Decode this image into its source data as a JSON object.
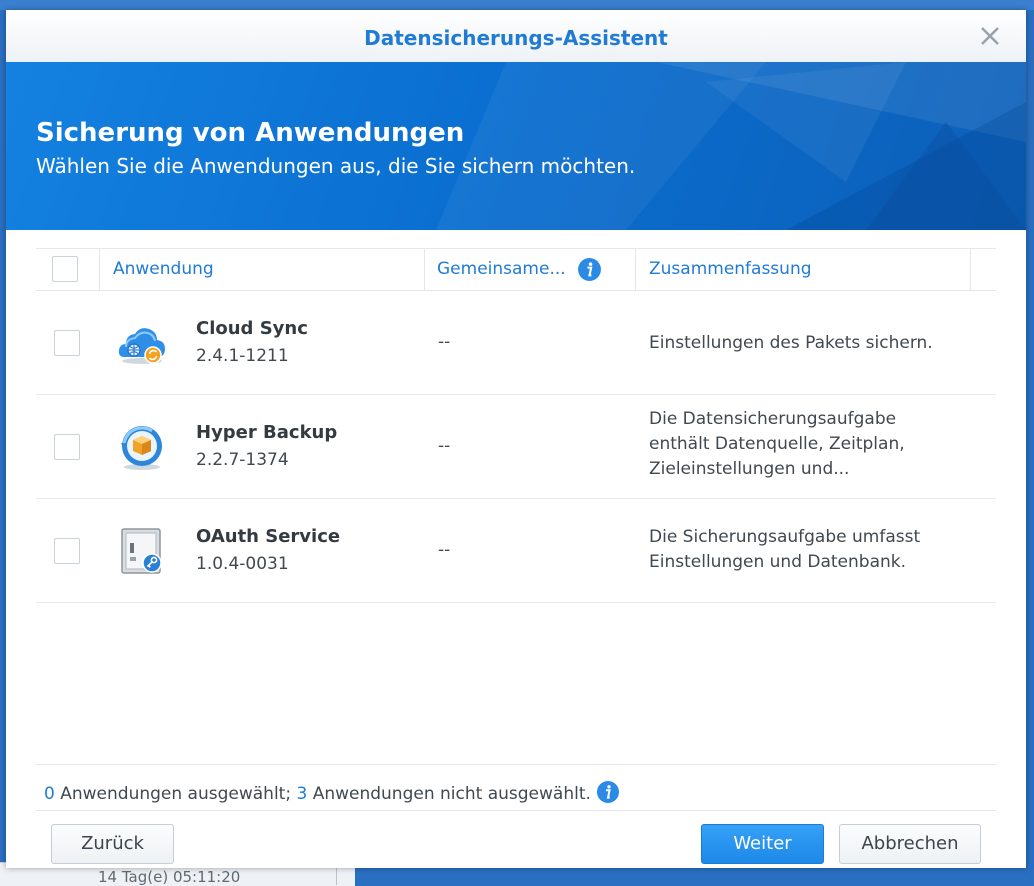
{
  "dialog": {
    "title": "Datensicherungs-Assistent",
    "heading": "Sicherung von Anwendungen",
    "subheading": "Wählen Sie die Anwendungen aus, die Sie sichern möchten."
  },
  "table": {
    "columns": {
      "application": "Anwendung",
      "shared": "Gemeinsame...",
      "summary": "Zusammenfassung"
    },
    "rows": [
      {
        "name": "Cloud Sync",
        "version": "2.4.1-1211",
        "shared": "--",
        "summary": [
          "Einstellungen des Pakets sichern."
        ],
        "icon": "cloud-sync-icon",
        "selected": false
      },
      {
        "name": "Hyper Backup",
        "version": "2.2.7-1374",
        "shared": "--",
        "summary": [
          "Die Datensicherungsaufgabe",
          "enthält Datenquelle, Zeitplan,",
          "Zieleinstellungen und..."
        ],
        "icon": "hyper-backup-icon",
        "selected": false
      },
      {
        "name": "OAuth Service",
        "version": "1.0.4-0031",
        "shared": "--",
        "summary": [
          "Die Sicherungsaufgabe umfasst",
          "Einstellungen und Datenbank."
        ],
        "icon": "oauth-service-icon",
        "selected": false
      }
    ]
  },
  "status": {
    "selected_count": "0",
    "selected_text": "Anwendungen ausgewählt;",
    "unselected_count": "3",
    "unselected_text": "Anwendungen nicht ausgewählt."
  },
  "buttons": {
    "back": "Zurück",
    "next": "Weiter",
    "cancel": "Abbrechen"
  },
  "background": {
    "footer_text": "14 Tag(e) 05:11:20"
  },
  "colors": {
    "accent": "#1f7bd4",
    "banner": "#0a6fd1",
    "primary_button": "#2493ee"
  }
}
